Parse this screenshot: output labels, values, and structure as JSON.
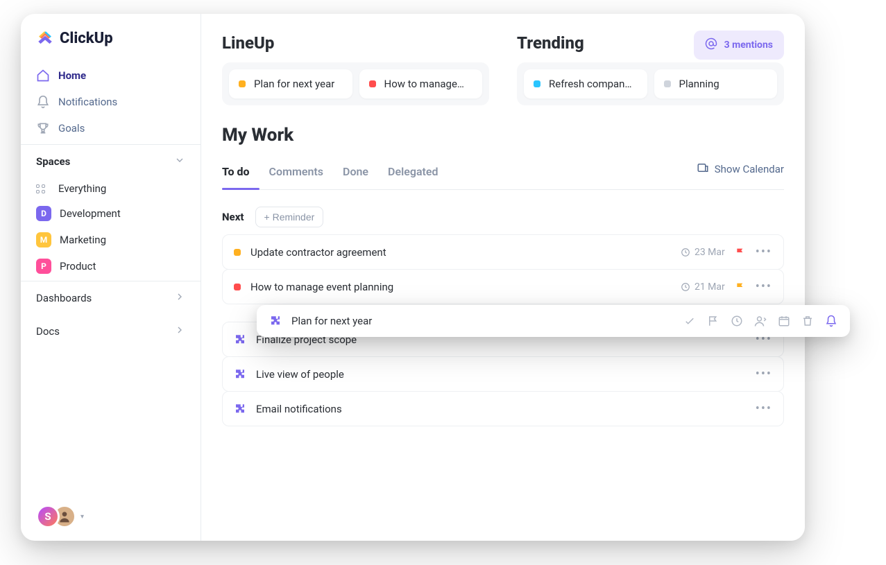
{
  "app_name": "ClickUp",
  "sidebar": {
    "nav": [
      {
        "label": "Home",
        "active": true
      },
      {
        "label": "Notifications",
        "active": false
      },
      {
        "label": "Goals",
        "active": false
      }
    ],
    "spaces_title": "Spaces",
    "everything_label": "Everything",
    "spaces": [
      {
        "letter": "D",
        "label": "Development",
        "badge": "b-purple"
      },
      {
        "letter": "M",
        "label": "Marketing",
        "badge": "b-yellow"
      },
      {
        "letter": "P",
        "label": "Product",
        "badge": "b-pink"
      }
    ],
    "dashboards_label": "Dashboards",
    "docs_label": "Docs",
    "avatar_initial": "S"
  },
  "mentions": {
    "text": "3 mentions"
  },
  "lineup": {
    "title": "LineUp",
    "cards": [
      {
        "color": "d-orange",
        "label": "Plan for next year"
      },
      {
        "color": "d-red",
        "label": "How to manage…"
      }
    ]
  },
  "trending": {
    "title": "Trending",
    "cards": [
      {
        "color": "d-cyan",
        "label": "Refresh compan…"
      },
      {
        "color": "d-grey",
        "label": "Planning"
      }
    ]
  },
  "mywork": {
    "title": "My Work",
    "tabs": [
      "To do",
      "Comments",
      "Done",
      "Delegated"
    ],
    "active_tab_index": 0,
    "show_calendar": "Show Calendar",
    "next_label": "Next",
    "reminder_label": "+ Reminder",
    "tasks_a": [
      {
        "color": "d-orange",
        "title": "Update contractor agreement",
        "date": "23 Mar",
        "flag": "red"
      },
      {
        "color": "d-red",
        "title": "How to manage event planning",
        "date": "21 Mar",
        "flag": "yellow"
      }
    ],
    "tasks_b": [
      {
        "title": "Finalize project scope"
      },
      {
        "title": "Live view of people"
      },
      {
        "title": "Email notifications"
      }
    ]
  },
  "hover_card": {
    "title": "Plan for next year"
  }
}
